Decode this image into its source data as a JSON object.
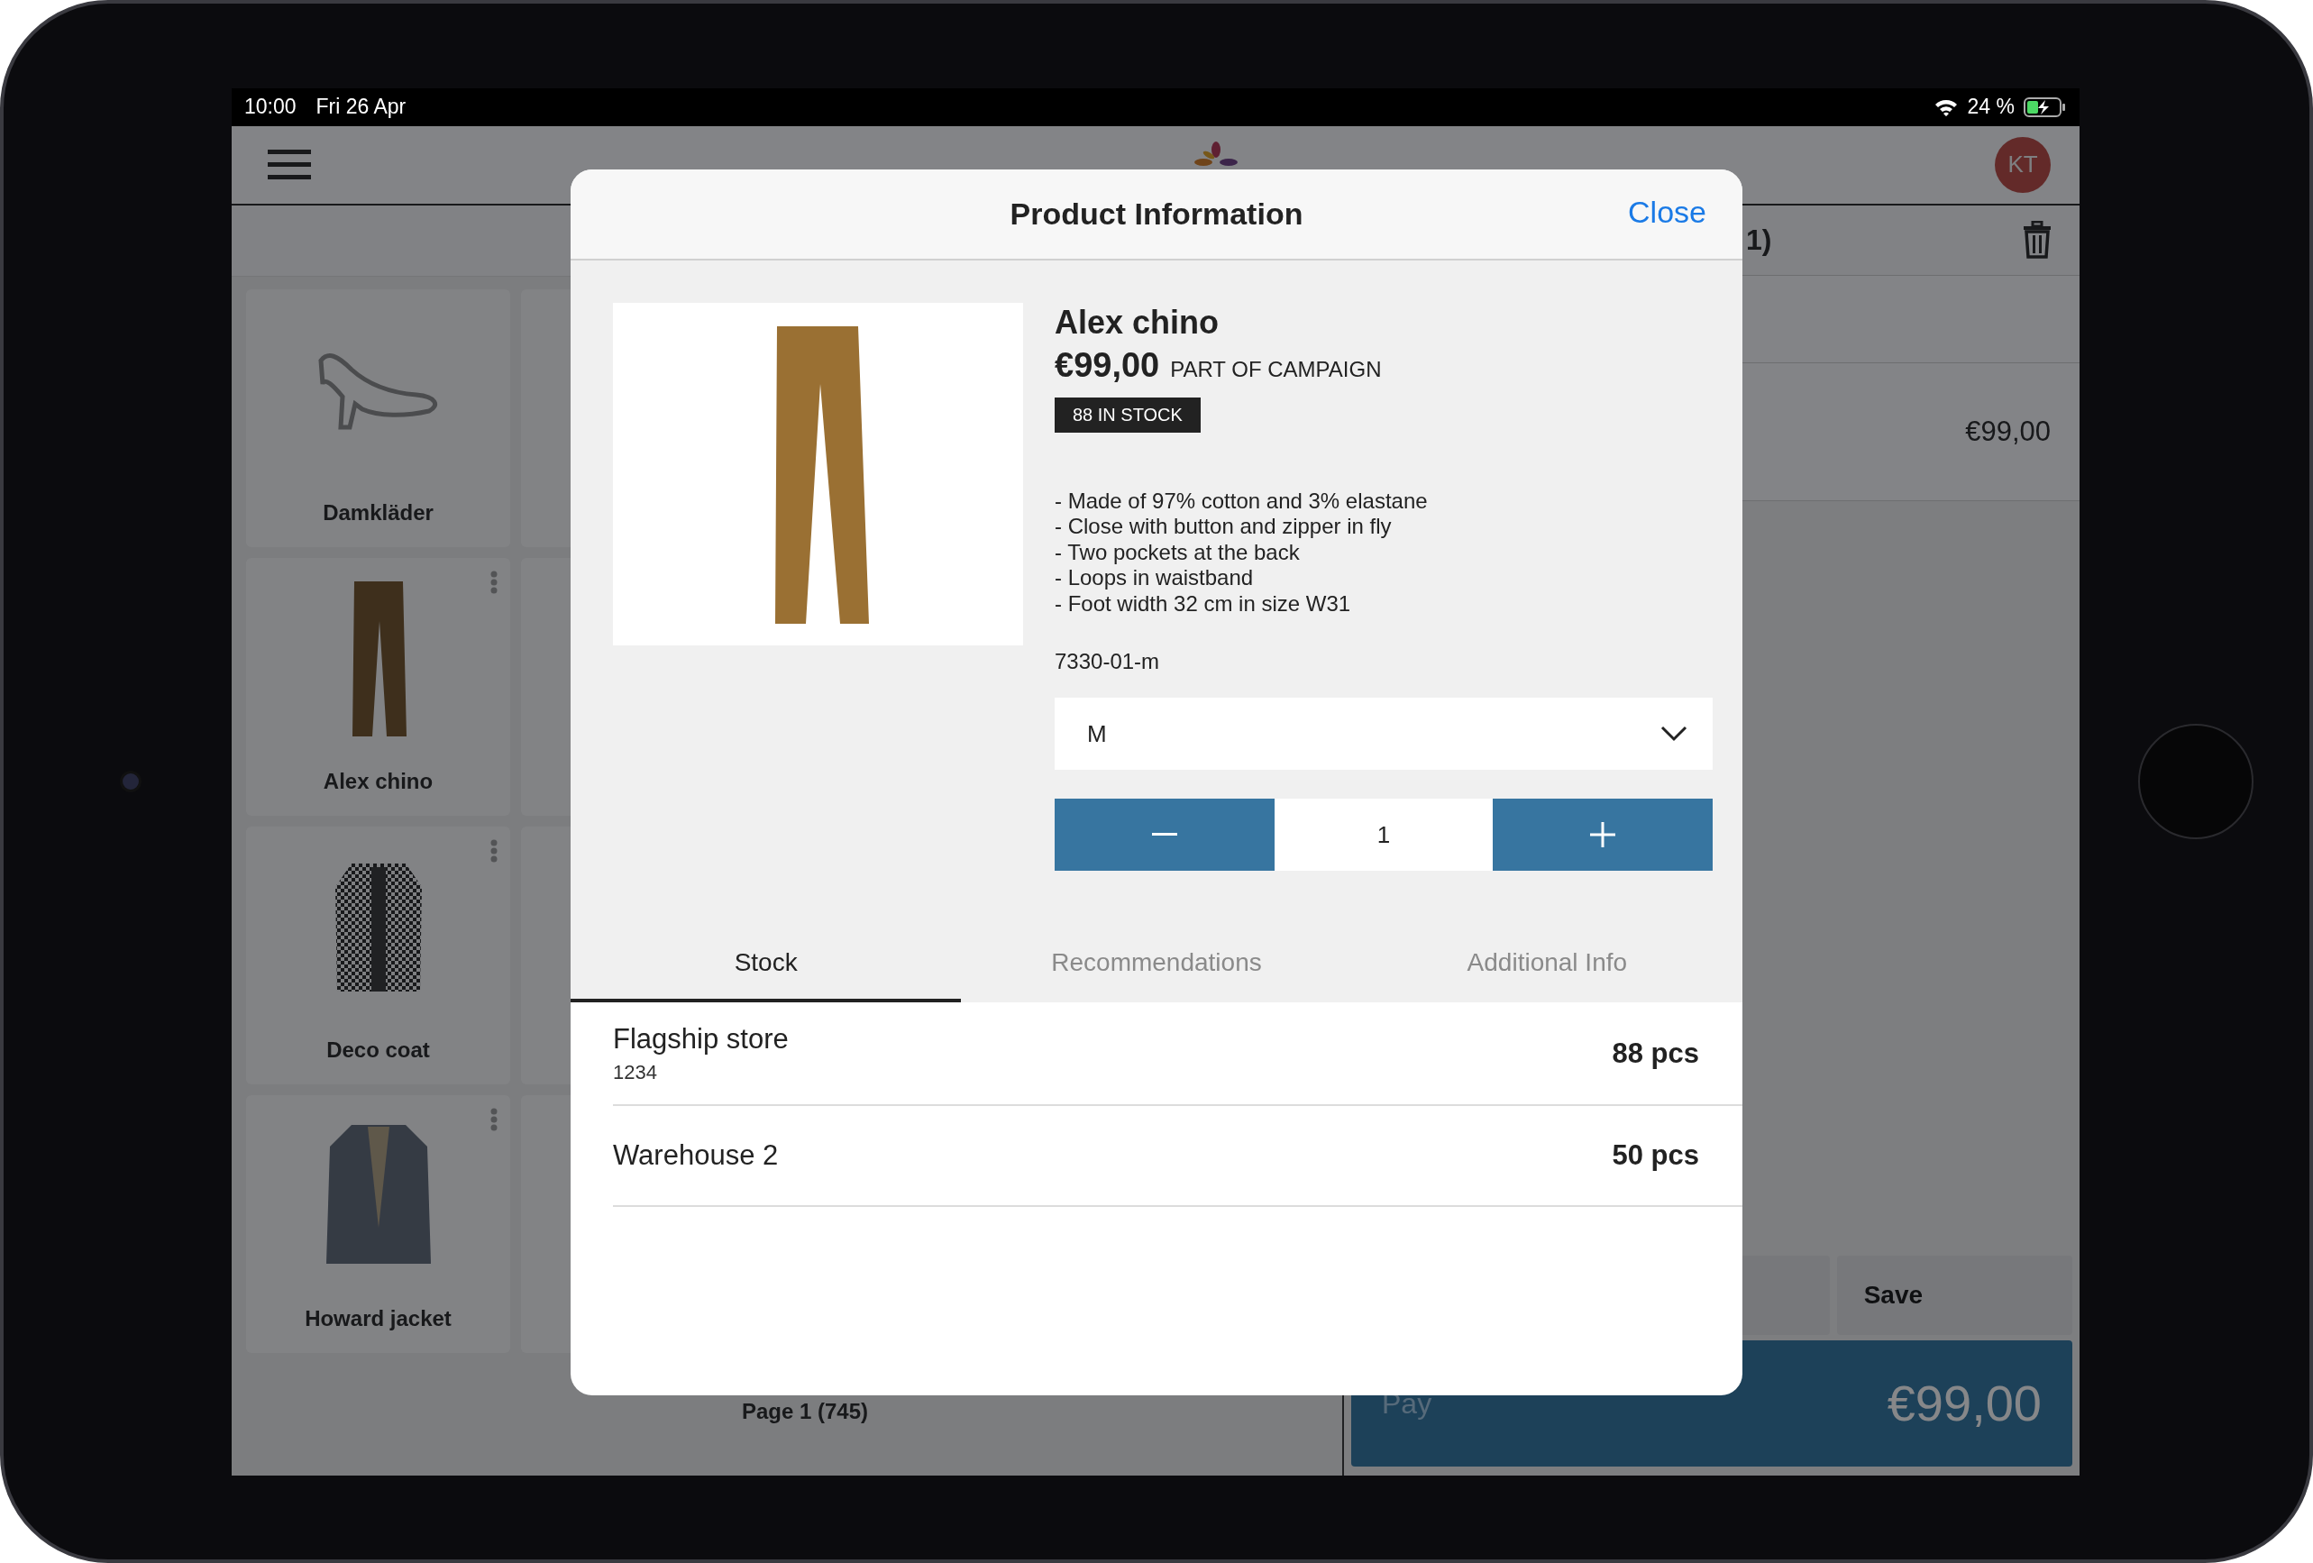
{
  "status_bar": {
    "time": "10:00",
    "date": "Fri 26 Apr",
    "battery": "24 %"
  },
  "header": {
    "avatar": "KT"
  },
  "tiles": [
    {
      "kind": "category",
      "label": "Damkläder"
    },
    {
      "kind": "product",
      "label": "Alex chino"
    },
    {
      "kind": "product",
      "label": "Deco coat"
    },
    {
      "kind": "product",
      "label": "Howard jacket"
    }
  ],
  "pager": "Page 1 (745)",
  "cart": {
    "title": "1)",
    "items": [
      {
        "price": "€99,00"
      }
    ],
    "buttons": [
      "Save"
    ],
    "pay": {
      "label": "Pay",
      "total": "€99,00"
    }
  },
  "modal": {
    "title": "Product Information",
    "close": "Close",
    "product": {
      "name": "Alex chino",
      "price": "€99,00",
      "campaign": "PART OF CAMPAIGN",
      "stock_badge": "88 IN STOCK",
      "description": [
        "- Made of 97% cotton and 3% elastane",
        "- Close with button and zipper in fly",
        "- Two pockets at the back",
        "- Loops in waistband",
        "- Foot width 32 cm in size W31"
      ],
      "sku": "7330-01-m"
    },
    "size": {
      "value": "M"
    },
    "quantity": {
      "value": "1"
    },
    "tabs": [
      {
        "label": "Stock",
        "selected": true
      },
      {
        "label": "Recommendations",
        "selected": false
      },
      {
        "label": "Additional Info",
        "selected": false
      }
    ],
    "stock": [
      {
        "location": "Flagship store",
        "code": "1234",
        "quantity": "88 pcs"
      },
      {
        "location": "Warehouse 2",
        "quantity": "50 pcs"
      }
    ]
  }
}
